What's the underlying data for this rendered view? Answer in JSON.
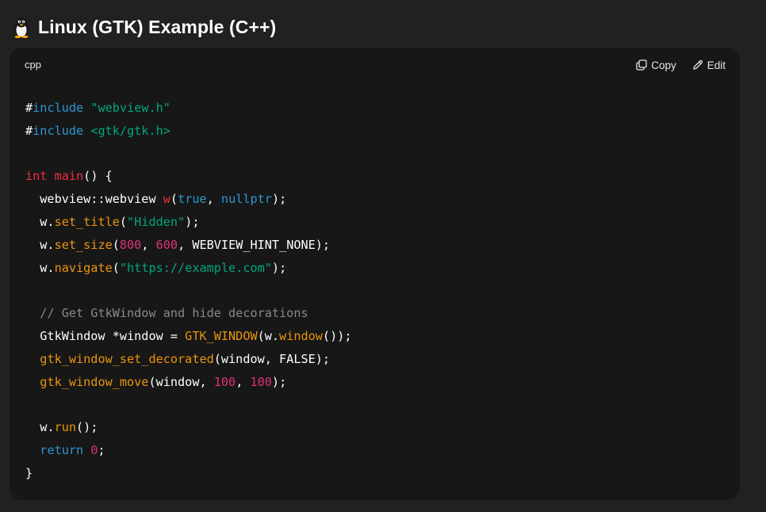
{
  "heading": {
    "emoji_icon": "penguin-icon",
    "title": "Linux (GTK) Example (C++)"
  },
  "code_block": {
    "language": "cpp",
    "copy_label": "Copy",
    "edit_label": "Edit",
    "colors": {
      "background": "#171717",
      "preprocessor": "#2e95d3",
      "string": "#00a67d",
      "keyword": "#f22c3d",
      "number": "#df3079",
      "function_call": "#e9950c",
      "comment": "#8a8a8a"
    },
    "lines": [
      [
        {
          "t": "#",
          "c": "plain"
        },
        {
          "t": "include",
          "c": "pre"
        },
        {
          "t": " ",
          "c": "plain"
        },
        {
          "t": "\"webview.h\"",
          "c": "str"
        }
      ],
      [
        {
          "t": "#",
          "c": "plain"
        },
        {
          "t": "include",
          "c": "pre"
        },
        {
          "t": " ",
          "c": "plain"
        },
        {
          "t": "<gtk/gtk.h>",
          "c": "str"
        }
      ],
      [],
      [
        {
          "t": "int",
          "c": "kw"
        },
        {
          "t": " ",
          "c": "plain"
        },
        {
          "t": "main",
          "c": "fn"
        },
        {
          "t": "() {",
          "c": "plain"
        }
      ],
      [
        {
          "t": "  webview::webview ",
          "c": "plain"
        },
        {
          "t": "w",
          "c": "fn"
        },
        {
          "t": "(",
          "c": "plain"
        },
        {
          "t": "true",
          "c": "lit"
        },
        {
          "t": ", ",
          "c": "plain"
        },
        {
          "t": "nullptr",
          "c": "lit"
        },
        {
          "t": ");",
          "c": "plain"
        }
      ],
      [
        {
          "t": "  w.",
          "c": "plain"
        },
        {
          "t": "set_title",
          "c": "call"
        },
        {
          "t": "(",
          "c": "plain"
        },
        {
          "t": "\"Hidden\"",
          "c": "str"
        },
        {
          "t": ");",
          "c": "plain"
        }
      ],
      [
        {
          "t": "  w.",
          "c": "plain"
        },
        {
          "t": "set_size",
          "c": "call"
        },
        {
          "t": "(",
          "c": "plain"
        },
        {
          "t": "800",
          "c": "num"
        },
        {
          "t": ", ",
          "c": "plain"
        },
        {
          "t": "600",
          "c": "num"
        },
        {
          "t": ", WEBVIEW_HINT_NONE);",
          "c": "plain"
        }
      ],
      [
        {
          "t": "  w.",
          "c": "plain"
        },
        {
          "t": "navigate",
          "c": "call"
        },
        {
          "t": "(",
          "c": "plain"
        },
        {
          "t": "\"https://example.com\"",
          "c": "str"
        },
        {
          "t": ");",
          "c": "plain"
        }
      ],
      [],
      [
        {
          "t": "  ",
          "c": "plain"
        },
        {
          "t": "// Get GtkWindow and hide decorations",
          "c": "com"
        }
      ],
      [
        {
          "t": "  GtkWindow *window = ",
          "c": "plain"
        },
        {
          "t": "GTK_WINDOW",
          "c": "call"
        },
        {
          "t": "(w.",
          "c": "plain"
        },
        {
          "t": "window",
          "c": "call"
        },
        {
          "t": "());",
          "c": "plain"
        }
      ],
      [
        {
          "t": "  ",
          "c": "plain"
        },
        {
          "t": "gtk_window_set_decorated",
          "c": "call"
        },
        {
          "t": "(window, FALSE);",
          "c": "plain"
        }
      ],
      [
        {
          "t": "  ",
          "c": "plain"
        },
        {
          "t": "gtk_window_move",
          "c": "call"
        },
        {
          "t": "(window, ",
          "c": "plain"
        },
        {
          "t": "100",
          "c": "num"
        },
        {
          "t": ", ",
          "c": "plain"
        },
        {
          "t": "100",
          "c": "num"
        },
        {
          "t": ");",
          "c": "plain"
        }
      ],
      [],
      [
        {
          "t": "  w.",
          "c": "plain"
        },
        {
          "t": "run",
          "c": "call"
        },
        {
          "t": "();",
          "c": "plain"
        }
      ],
      [
        {
          "t": "  ",
          "c": "plain"
        },
        {
          "t": "return",
          "c": "lit"
        },
        {
          "t": " ",
          "c": "plain"
        },
        {
          "t": "0",
          "c": "num"
        },
        {
          "t": ";",
          "c": "plain"
        }
      ],
      [
        {
          "t": "}",
          "c": "plain"
        }
      ]
    ]
  }
}
